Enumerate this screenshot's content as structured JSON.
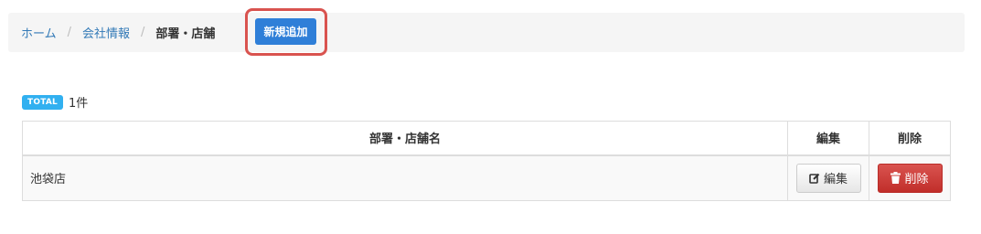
{
  "breadcrumb": {
    "home": "ホーム",
    "company_info": "会社情報",
    "current": "部署・店舗",
    "separator": "/"
  },
  "actions": {
    "add_new_label": "新規追加"
  },
  "summary": {
    "total_badge": "TOTAL",
    "total_count": "1件"
  },
  "table": {
    "headers": {
      "name": "部署・店舗名",
      "edit": "編集",
      "delete": "削除"
    },
    "rows": [
      {
        "name": "池袋店",
        "edit_label": "編集",
        "delete_label": "削除"
      }
    ]
  },
  "colors": {
    "primary": "#2f7fd8",
    "danger": "#d9534f",
    "info": "#31b0f0",
    "link": "#337ab7"
  },
  "icons": {
    "edit": "edit-icon",
    "delete": "trash-icon"
  }
}
